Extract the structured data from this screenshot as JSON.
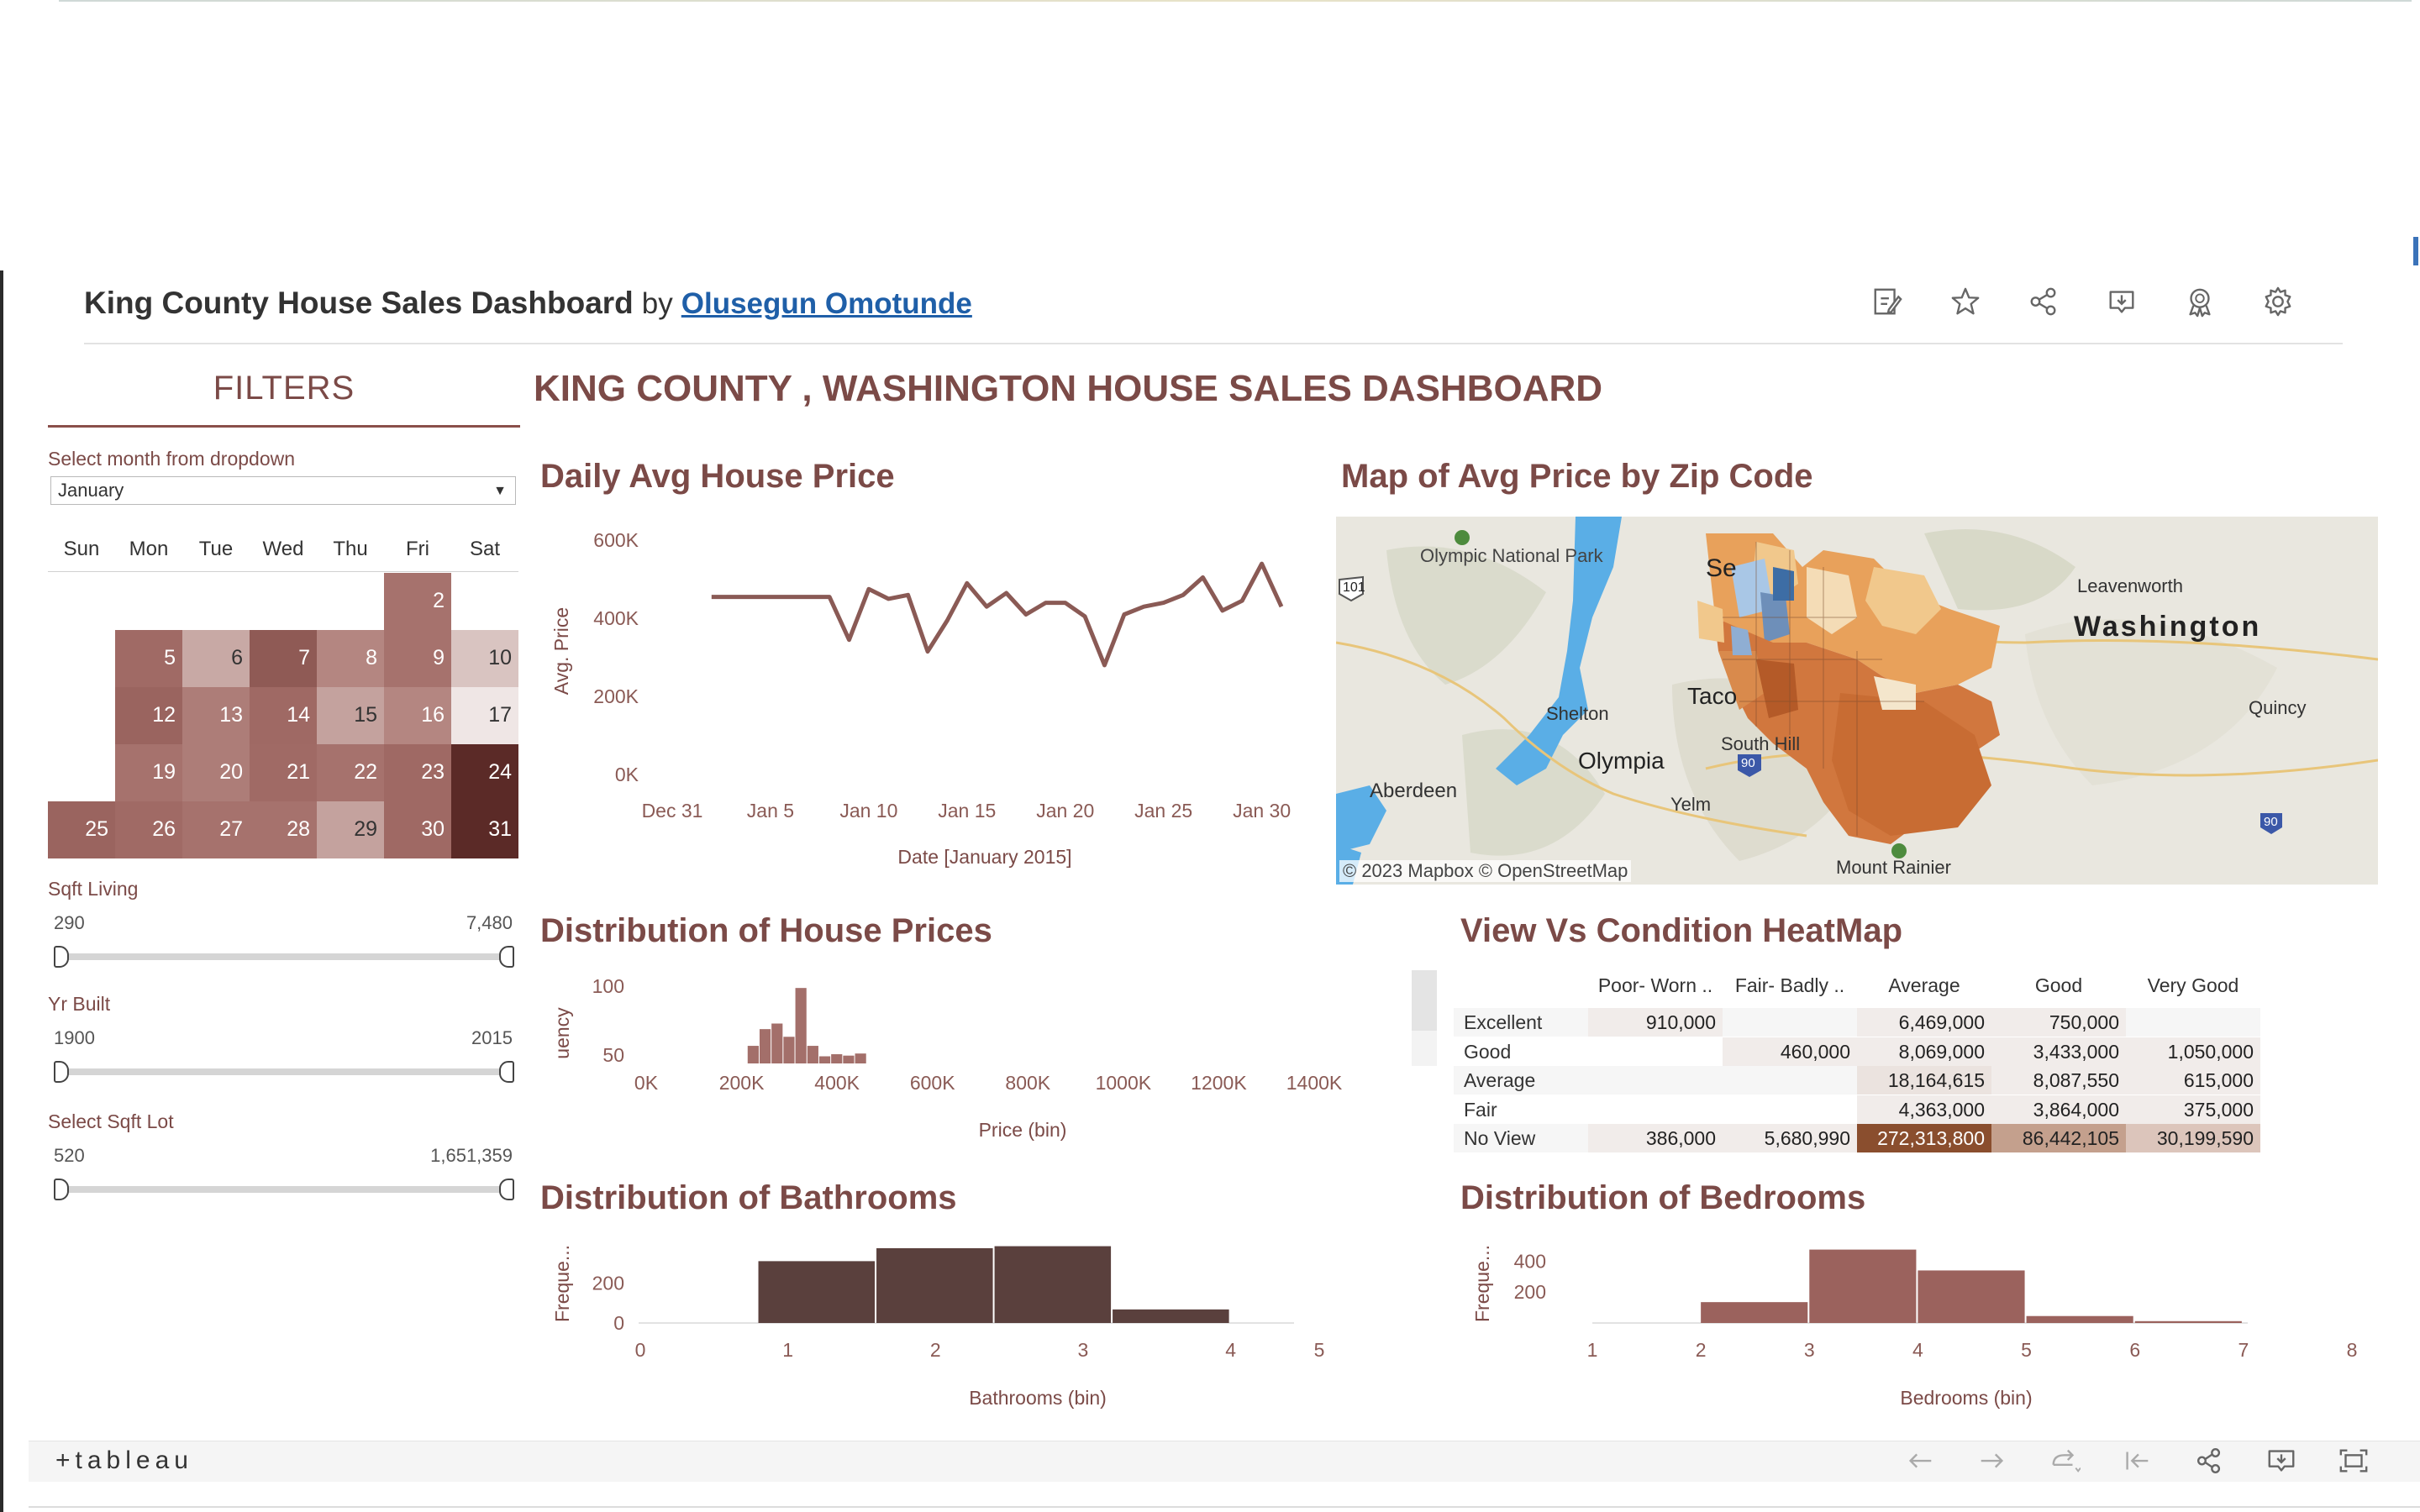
{
  "header": {
    "title": "King County House Sales Dashboard",
    "by": "by",
    "author": "Olusegun Omotunde",
    "icons": [
      "edit-icon",
      "star-icon",
      "share-icon",
      "download-icon",
      "badge-icon",
      "gear-icon"
    ]
  },
  "filters": {
    "title": "FILTERS",
    "month_label": "Select month from dropdown",
    "month_value": "January",
    "weekdays": [
      "Sun",
      "Mon",
      "Tue",
      "Wed",
      "Thu",
      "Fri",
      "Sat"
    ],
    "days": [
      {
        "d": "2",
        "row": 0,
        "col": 5,
        "shade": "#a6726d",
        "dark": false
      },
      {
        "d": "5",
        "row": 1,
        "col": 1,
        "shade": "#a06a65",
        "dark": false
      },
      {
        "d": "6",
        "row": 1,
        "col": 2,
        "shade": "#c8a9a5",
        "dark": true
      },
      {
        "d": "7",
        "row": 1,
        "col": 3,
        "shade": "#8f5a55",
        "dark": false
      },
      {
        "d": "8",
        "row": 1,
        "col": 4,
        "shade": "#b48681",
        "dark": false
      },
      {
        "d": "9",
        "row": 1,
        "col": 5,
        "shade": "#a6726d",
        "dark": false
      },
      {
        "d": "10",
        "row": 1,
        "col": 6,
        "shade": "#d9c4c1",
        "dark": true
      },
      {
        "d": "12",
        "row": 2,
        "col": 1,
        "shade": "#9a645f",
        "dark": false
      },
      {
        "d": "13",
        "row": 2,
        "col": 2,
        "shade": "#ad7d78",
        "dark": false
      },
      {
        "d": "14",
        "row": 2,
        "col": 3,
        "shade": "#9f6964",
        "dark": false
      },
      {
        "d": "15",
        "row": 2,
        "col": 4,
        "shade": "#c4a29e",
        "dark": true
      },
      {
        "d": "16",
        "row": 2,
        "col": 5,
        "shade": "#b48681",
        "dark": false
      },
      {
        "d": "17",
        "row": 2,
        "col": 6,
        "shade": "#efe6e5",
        "dark": true
      },
      {
        "d": "19",
        "row": 3,
        "col": 1,
        "shade": "#a6726d",
        "dark": false
      },
      {
        "d": "20",
        "row": 3,
        "col": 2,
        "shade": "#ad7d78",
        "dark": false
      },
      {
        "d": "21",
        "row": 3,
        "col": 3,
        "shade": "#a06a65",
        "dark": false
      },
      {
        "d": "22",
        "row": 3,
        "col": 4,
        "shade": "#a6726d",
        "dark": false
      },
      {
        "d": "23",
        "row": 3,
        "col": 5,
        "shade": "#9f6964",
        "dark": false
      },
      {
        "d": "24",
        "row": 3,
        "col": 6,
        "shade": "#5b2a27",
        "dark": false
      },
      {
        "d": "25",
        "row": 4,
        "col": 0,
        "shade": "#9a645f",
        "dark": false
      },
      {
        "d": "26",
        "row": 4,
        "col": 1,
        "shade": "#a06a65",
        "dark": false
      },
      {
        "d": "27",
        "row": 4,
        "col": 2,
        "shade": "#a6726d",
        "dark": false
      },
      {
        "d": "28",
        "row": 4,
        "col": 3,
        "shade": "#a6726d",
        "dark": false
      },
      {
        "d": "29",
        "row": 4,
        "col": 4,
        "shade": "#c4a29e",
        "dark": true
      },
      {
        "d": "30",
        "row": 4,
        "col": 5,
        "shade": "#9f6964",
        "dark": false
      },
      {
        "d": "31",
        "row": 4,
        "col": 6,
        "shade": "#5b2a27",
        "dark": false
      }
    ],
    "sliders": [
      {
        "label": "Sqft Living",
        "min": "290",
        "max": "7,480"
      },
      {
        "label": "Yr Built",
        "min": "1900",
        "max": "2015"
      },
      {
        "label": "Select  Sqft Lot",
        "min": "520",
        "max": "1,651,359"
      }
    ]
  },
  "dashboard_title": "KING COUNTY , WASHINGTON HOUSE SALES DASHBOARD",
  "sections": {
    "daily": "Daily Avg House Price",
    "map": "Map of Avg Price by Zip Code",
    "prices": "Distribution of House Prices",
    "heatmap": "View Vs Condition HeatMap",
    "bathrooms": "Distribution of Bathrooms",
    "bedrooms": "Distribution of Bedrooms"
  },
  "map": {
    "attribution": "© 2023 Mapbox  © OpenStreetMap",
    "labels": [
      "Olympic National Park",
      "Se",
      "Leavenworth",
      "Washington",
      "Shelton",
      "Taco",
      "Quincy",
      "Olympia",
      "South Hill",
      "Aberdeen",
      "Yelm",
      "Mount Rainier",
      "101",
      "90",
      "90"
    ]
  },
  "chart_data": [
    {
      "type": "line",
      "title": "Daily Avg House Price",
      "xlabel": "Date [January 2015]",
      "ylabel": "Avg. Price",
      "x_ticks": [
        "Dec 31",
        "Jan 5",
        "Jan 10",
        "Jan 15",
        "Jan 20",
        "Jan 25",
        "Jan 30"
      ],
      "y_ticks": [
        "0K",
        "200K",
        "400K",
        "600K"
      ],
      "ylim": [
        0,
        650000
      ],
      "x": [
        2,
        3,
        4,
        5,
        6,
        7,
        8,
        9,
        10,
        11,
        12,
        13,
        14,
        15,
        16,
        17,
        18,
        19,
        20,
        21,
        22,
        23,
        24,
        25,
        26,
        27,
        28,
        29,
        30,
        31
      ],
      "y": [
        455000,
        455000,
        455000,
        455000,
        455000,
        455000,
        455000,
        345000,
        475000,
        450000,
        460000,
        315000,
        395000,
        490000,
        430000,
        465000,
        410000,
        440000,
        440000,
        405000,
        280000,
        410000,
        430000,
        440000,
        460000,
        505000,
        420000,
        445000,
        540000,
        430000
      ],
      "series_color": "#8a5a55"
    },
    {
      "type": "bar",
      "title": "Distribution of House Prices",
      "xlabel": "Price (bin)",
      "ylabel": "uency",
      "x_ticks": [
        "0K",
        "200K",
        "400K",
        "600K",
        "800K",
        "1000K",
        "1200K",
        "1400K"
      ],
      "y_ticks": [
        "100",
        "50"
      ],
      "xlim": [
        0,
        1400000
      ],
      "bins": [
        200000,
        225000,
        250000,
        275000,
        300000,
        325000,
        350000,
        375000,
        400000,
        425000,
        450000,
        475000
      ],
      "values": [
        0,
        18,
        42,
        50,
        31,
        101,
        18,
        3,
        6,
        4,
        7,
        0
      ],
      "series_color": "#a36f6a"
    },
    {
      "type": "table",
      "title": "View Vs Condition HeatMap",
      "columns": [
        "Poor- Worn ..",
        "Fair- Badly ..",
        "Average",
        "Good",
        "Very Good"
      ],
      "rows": [
        {
          "label": "Excellent",
          "values": [
            "910,000",
            "",
            "6,469,000",
            "750,000",
            ""
          ]
        },
        {
          "label": "Good",
          "values": [
            "",
            "460,000",
            "8,069,000",
            "3,433,000",
            "1,050,000"
          ]
        },
        {
          "label": "Average",
          "values": [
            "",
            "",
            "18,164,615",
            "8,087,550",
            "615,000"
          ]
        },
        {
          "label": "Fair",
          "values": [
            "",
            "",
            "4,363,000",
            "3,864,000",
            "375,000"
          ]
        },
        {
          "label": "No View",
          "values": [
            "386,000",
            "5,680,990",
            "272,313,800",
            "86,442,105",
            "30,199,590"
          ]
        }
      ]
    },
    {
      "type": "bar",
      "title": "Distribution of Bathrooms",
      "xlabel": "Bathrooms (bin)",
      "ylabel": "Freque...",
      "x_ticks": [
        "0",
        "1",
        "2",
        "3",
        "4",
        "5"
      ],
      "y_ticks": [
        "200",
        "0"
      ],
      "bins": [
        0.8,
        1.6,
        2.4,
        3.2
      ],
      "values": [
        310,
        375,
        385,
        68
      ],
      "bin_width": 0.8,
      "series_color": "#5a403d"
    },
    {
      "type": "bar",
      "title": "Distribution of Bedrooms",
      "xlabel": "Bedrooms (bin)",
      "ylabel": "Freque...",
      "x_ticks": [
        "1",
        "2",
        "3",
        "4",
        "5",
        "6",
        "7",
        "8"
      ],
      "y_ticks": [
        "400",
        "200"
      ],
      "bins": [
        2,
        3,
        4,
        5,
        6
      ],
      "values": [
        135,
        475,
        340,
        45,
        12
      ],
      "bin_width": 1,
      "series_color": "#9b625d"
    }
  ],
  "footer": {
    "logo": "+tableau",
    "icons": [
      "undo-icon",
      "redo-icon",
      "revert-icon",
      "reset-icon",
      "share-icon",
      "download-icon",
      "fullscreen-icon"
    ]
  }
}
